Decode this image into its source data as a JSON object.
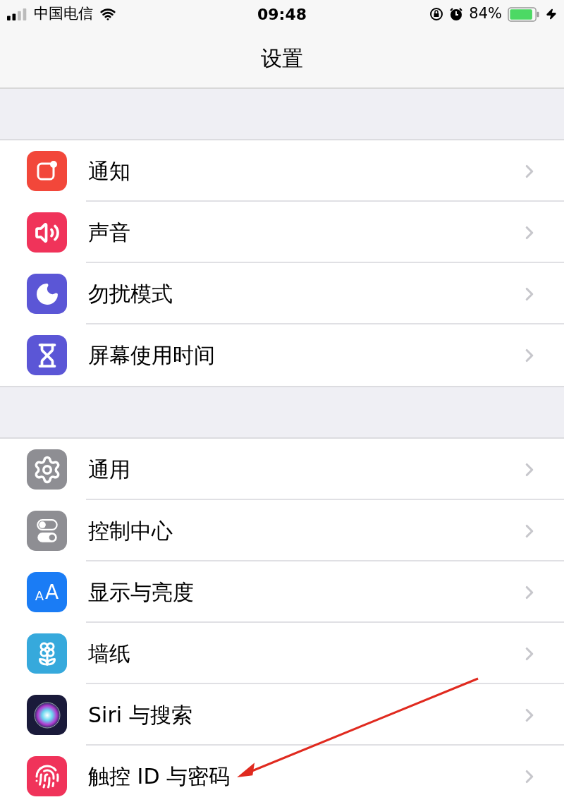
{
  "status_bar": {
    "carrier": "中国电信",
    "time": "09:48",
    "battery": "84%"
  },
  "nav": {
    "title": "设置"
  },
  "groups": [
    {
      "items": [
        {
          "label": "通知",
          "kind": "notifications",
          "color": "#f2473a"
        },
        {
          "label": "声音",
          "kind": "sound",
          "color": "#f0335a"
        },
        {
          "label": "勿扰模式",
          "kind": "moon",
          "color": "#5b56d6"
        },
        {
          "label": "屏幕使用时间",
          "kind": "hourglass",
          "color": "#5b56d6"
        }
      ]
    },
    {
      "items": [
        {
          "label": "通用",
          "kind": "gear",
          "color": "#8e8e93"
        },
        {
          "label": "控制中心",
          "kind": "toggles",
          "color": "#8e8e93"
        },
        {
          "label": "显示与亮度",
          "kind": "text",
          "icon_text": "AA",
          "color": "#1a7cf5"
        },
        {
          "label": "墙纸",
          "kind": "flower",
          "color": "#36a9dc"
        },
        {
          "label": "Siri 与搜索",
          "kind": "siri",
          "color": "#1a1a3a"
        },
        {
          "label": "触控 ID 与密码",
          "kind": "fingerprint",
          "color": "#f0335a"
        }
      ]
    }
  ]
}
